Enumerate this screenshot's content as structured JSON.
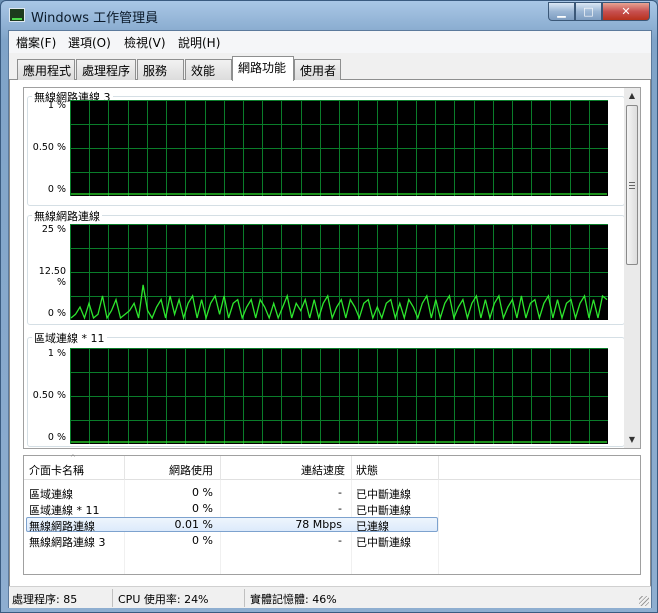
{
  "window": {
    "title": "Windows 工作管理員",
    "minimize_icon": "minimize-icon",
    "maximize_icon": "maximize-icon",
    "close_icon": "close-icon"
  },
  "menu": [
    "檔案(F)",
    "選項(O)",
    "檢視(V)",
    "說明(H)"
  ],
  "tabs": [
    "應用程式",
    "處理程序",
    "服務",
    "效能",
    "網路功能",
    "使用者"
  ],
  "active_tab": "網路功能",
  "chart_data": [
    {
      "type": "line",
      "title": "無線網路連線 3",
      "yticks": [
        "1 %",
        "0.50 %",
        "0 %"
      ],
      "ylim": [
        0,
        1
      ],
      "series": [
        {
          "values": [
            0,
            0,
            0,
            0,
            0,
            0,
            0,
            0,
            0,
            0,
            0,
            0,
            0,
            0,
            0,
            0,
            0,
            0,
            0,
            0
          ]
        }
      ],
      "grid": true,
      "line_color": "#2de52d"
    },
    {
      "type": "line",
      "title": "無線網路連線",
      "yticks": [
        "25 %",
        "12.50 %",
        "0 %"
      ],
      "ylim": [
        0,
        25
      ],
      "grid": true,
      "line_color": "#2de52d",
      "series": [
        {
          "values": [
            0,
            1,
            3,
            0,
            4,
            0,
            1,
            6,
            0,
            2,
            5,
            0,
            1,
            2,
            4,
            0,
            9,
            2,
            0,
            3,
            5,
            0,
            6,
            1,
            5,
            0,
            4,
            6,
            0,
            5,
            0,
            4,
            6,
            1,
            6,
            0,
            4,
            5,
            0,
            3,
            5,
            0,
            5,
            3,
            0,
            4,
            0,
            3,
            6,
            0,
            4,
            2,
            5,
            0,
            5,
            0,
            4,
            6,
            0,
            3,
            5,
            0,
            5,
            3,
            0,
            4,
            5,
            0,
            3,
            0,
            4,
            5,
            0,
            4,
            0,
            5,
            3,
            0,
            4,
            6,
            0,
            5,
            0,
            4,
            6,
            0,
            3,
            5,
            0,
            4,
            6,
            0,
            5,
            0,
            4,
            6,
            0,
            3,
            5,
            0,
            6,
            0,
            4,
            5,
            0,
            4,
            6,
            0,
            5,
            0,
            4,
            5,
            0,
            4,
            6,
            0,
            5,
            0,
            6,
            5
          ]
        }
      ]
    },
    {
      "type": "line",
      "title": "區域連線 * 11",
      "yticks": [
        "1 %",
        "0.50 %",
        "0 %"
      ],
      "ylim": [
        0,
        1
      ],
      "series": [
        {
          "values": [
            0,
            0,
            0,
            0,
            0,
            0,
            0,
            0,
            0,
            0,
            0,
            0,
            0,
            0,
            0,
            0,
            0,
            0,
            0,
            0
          ]
        }
      ],
      "grid": true,
      "line_color": "#2de52d"
    }
  ],
  "table": {
    "headers": [
      "介面卡名稱",
      "網路使用",
      "連結速度",
      "狀態"
    ],
    "rows": [
      {
        "name": "區域連線",
        "usage": "0 %",
        "speed": "-",
        "status": "已中斷連線"
      },
      {
        "name": "區域連線 * 11",
        "usage": "0 %",
        "speed": "-",
        "status": "已中斷連線"
      },
      {
        "name": "無線網路連線",
        "usage": "0.01 %",
        "speed": "78 Mbps",
        "status": "已連線",
        "selected": true
      },
      {
        "name": "無線網路連線 3",
        "usage": "0 %",
        "speed": "-",
        "status": "已中斷連線"
      }
    ]
  },
  "status": {
    "processes": "處理程序: 85",
    "cpu": "CPU 使用率: 24%",
    "memory": "實體記憶體: 46%"
  }
}
